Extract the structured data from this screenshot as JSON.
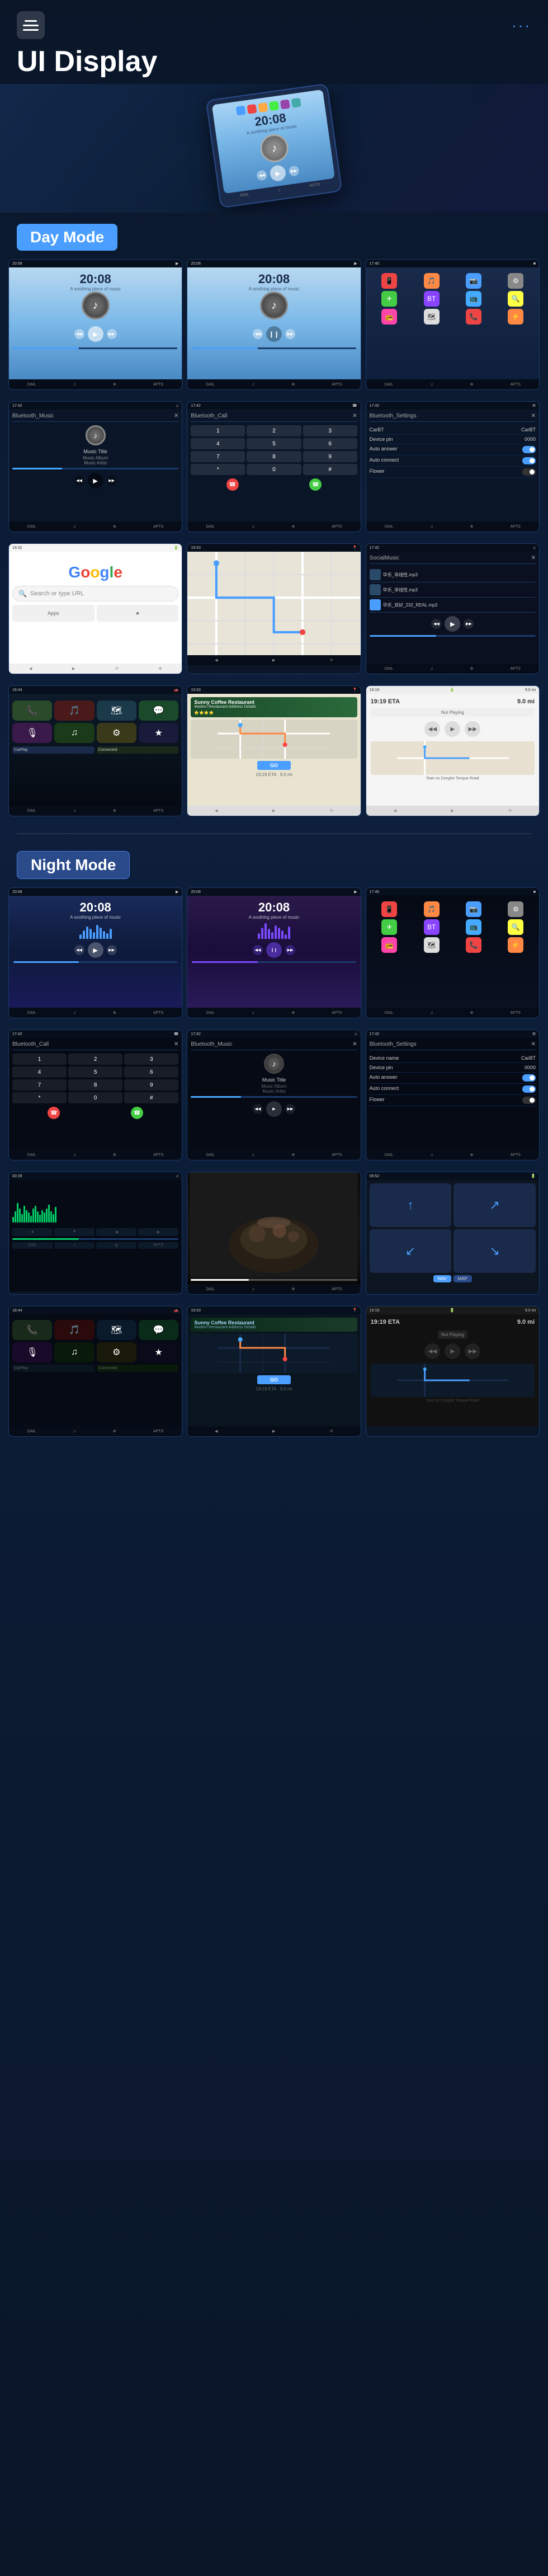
{
  "header": {
    "menu_icon": "≡",
    "menu_dots": "···",
    "title": "UI Display"
  },
  "sections": {
    "day_mode": "Day Mode",
    "night_mode": "Night Mode"
  },
  "screens": {
    "time": "20:08",
    "subtitle": "A soothing piece of music",
    "music_title": "Music Title",
    "music_album": "Music Album",
    "music_artist": "Music Artist",
    "bluetooth_music": "Bluetooth_Music",
    "bluetooth_call": "Bluetooth_Call",
    "bluetooth_settings": "Bluetooth_Settings",
    "device_name": "CarBT",
    "device_pin": "0000",
    "auto_answer": "Auto answer",
    "auto_connect": "Auto connect",
    "flower": "Flower",
    "google_placeholder": "Search or type URL",
    "local_music": "SocialMusic",
    "sunny_coffee": "Sunny Coffee Restaurant",
    "sunny_coffee_addr": "Modern Restaurant Address Details",
    "go_label": "GO",
    "not_playing": "Not Playing",
    "nav_instruction": "Start on Donghe Tonque Road",
    "eta_label": "19:19 ETA",
    "distance": "9.0 mi",
    "dial_keys": [
      "1",
      "2",
      "3",
      "4",
      "5",
      "6",
      "7",
      "8",
      "9",
      "*",
      "0",
      "#"
    ],
    "wave_heights": [
      8,
      15,
      22,
      18,
      12,
      25,
      20,
      14,
      10,
      18,
      24,
      16,
      11,
      20,
      15
    ],
    "wave_heights_green": [
      10,
      20,
      35,
      25,
      15,
      30,
      22,
      18,
      12,
      25,
      30,
      20,
      14,
      22,
      18,
      25,
      32,
      20,
      15,
      28
    ]
  }
}
